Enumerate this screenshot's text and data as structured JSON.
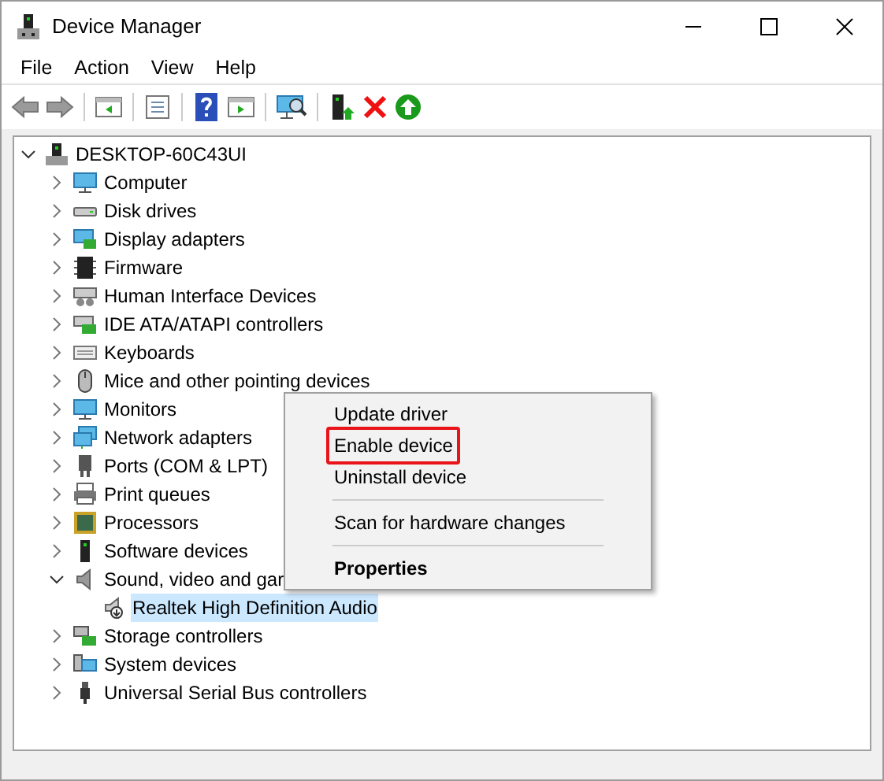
{
  "window": {
    "title": "Device Manager"
  },
  "menu": [
    "File",
    "Action",
    "View",
    "Help"
  ],
  "tree": {
    "label": "DESKTOP-60C43UI",
    "expanded": true,
    "children": [
      {
        "label": "Computer",
        "expanded": false
      },
      {
        "label": "Disk drives",
        "expanded": false
      },
      {
        "label": "Display adapters",
        "expanded": false
      },
      {
        "label": "Firmware",
        "expanded": false
      },
      {
        "label": "Human Interface Devices",
        "expanded": false
      },
      {
        "label": "IDE ATA/ATAPI controllers",
        "expanded": false
      },
      {
        "label": "Keyboards",
        "expanded": false
      },
      {
        "label": "Mice and other pointing devices",
        "expanded": false
      },
      {
        "label": "Monitors",
        "expanded": false
      },
      {
        "label": "Network adapters",
        "expanded": false
      },
      {
        "label": "Ports (COM & LPT)",
        "expanded": false
      },
      {
        "label": "Print queues",
        "expanded": false
      },
      {
        "label": "Processors",
        "expanded": false
      },
      {
        "label": "Software devices",
        "expanded": false
      },
      {
        "label": "Sound, video and gar",
        "expanded": true,
        "children": [
          {
            "label": "Realtek High Definition Audio",
            "selected": true
          }
        ]
      },
      {
        "label": "Storage controllers",
        "expanded": false
      },
      {
        "label": "System devices",
        "expanded": false
      },
      {
        "label": "Universal Serial Bus controllers",
        "expanded": false
      }
    ]
  },
  "context_menu": [
    {
      "kind": "item",
      "label": "Update driver",
      "default": false,
      "highlighted": false
    },
    {
      "kind": "item",
      "label": "Enable device",
      "default": false,
      "highlighted": true
    },
    {
      "kind": "item",
      "label": "Uninstall device",
      "default": false,
      "highlighted": false
    },
    {
      "kind": "separator"
    },
    {
      "kind": "item",
      "label": "Scan for hardware changes",
      "default": false,
      "highlighted": false
    },
    {
      "kind": "separator"
    },
    {
      "kind": "item",
      "label": "Properties",
      "default": true,
      "highlighted": false
    }
  ]
}
